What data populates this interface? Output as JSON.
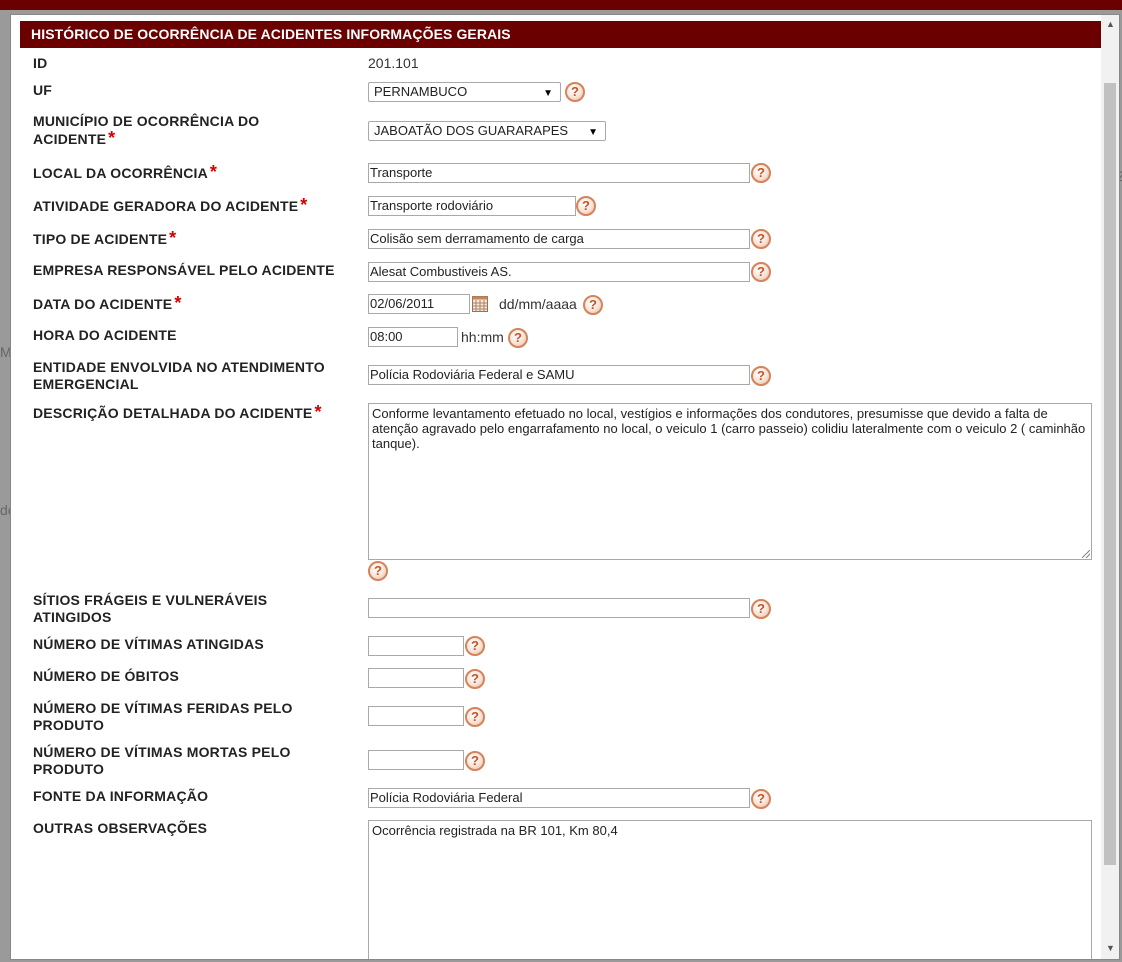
{
  "background": {
    "frag_mb": "MB",
    "frag_do": "do",
    "frag_z": "Z"
  },
  "header": {
    "title": "HISTÓRICO DE OCORRÊNCIA DE ACIDENTES INFORMAÇÕES GERAIS"
  },
  "required_mark": "*",
  "help_glyph": "?",
  "fields": {
    "id": {
      "label": "ID",
      "value": "201.101"
    },
    "uf": {
      "label": "UF",
      "value": "PERNAMBUCO"
    },
    "municipio": {
      "label_line1": "MUNICÍPIO DE OCORRÊNCIA DO",
      "label_line2": "ACIDENTE",
      "value": "JABOATÃO DOS GUARARAPES"
    },
    "local": {
      "label": "LOCAL DA OCORRÊNCIA",
      "value": "Transporte"
    },
    "atividade": {
      "label": "ATIVIDADE GERADORA DO ACIDENTE",
      "value": "Transporte rodoviário"
    },
    "tipo": {
      "label": "TIPO DE ACIDENTE",
      "value": "Colisão sem derramamento de carga"
    },
    "empresa": {
      "label": "EMPRESA RESPONSÁVEL PELO ACIDENTE",
      "value": "Alesat Combustiveis AS."
    },
    "data": {
      "label": "DATA DO ACIDENTE",
      "value": "02/06/2011",
      "hint": "dd/mm/aaaa"
    },
    "hora": {
      "label": "HORA DO ACIDENTE",
      "value": "08:00",
      "hint": "hh:mm"
    },
    "entidade": {
      "label_line1": "ENTIDADE ENVOLVIDA NO ATENDIMENTO",
      "label_line2": "EMERGENCIAL",
      "value": "Polícia Rodoviária Federal e SAMU"
    },
    "descricao": {
      "label": "DESCRIÇÃO DETALHADA DO ACIDENTE",
      "value": "Conforme levantamento efetuado no local, vestígios e informações dos condutores, presumisse que devido a falta de atenção agravado pelo engarrafamento no local, o veiculo 1 (carro passeio) colidiu lateralmente com o veiculo 2 ( caminhão tanque)."
    },
    "sitios": {
      "label_line1": "SÍTIOS FRÁGEIS E VULNERÁVEIS",
      "label_line2": "ATINGIDOS",
      "value": ""
    },
    "vitimas": {
      "label": "NÚMERO DE VÍTIMAS ATINGIDAS",
      "value": ""
    },
    "obitos": {
      "label": "NÚMERO DE ÓBITOS",
      "value": ""
    },
    "feridas": {
      "label_line1": "NÚMERO DE VÍTIMAS FERIDAS PELO",
      "label_line2": "PRODUTO",
      "value": ""
    },
    "mortas": {
      "label_line1": "NÚMERO DE VÍTIMAS MORTAS PELO",
      "label_line2": "PRODUTO",
      "value": ""
    },
    "fonte": {
      "label": "FONTE DA INFORMAÇÃO",
      "value": "Polícia Rodoviária Federal"
    },
    "outras": {
      "label": "OUTRAS OBSERVAÇÕES",
      "value": "Ocorrência registrada na BR 101, Km 80,4"
    }
  }
}
